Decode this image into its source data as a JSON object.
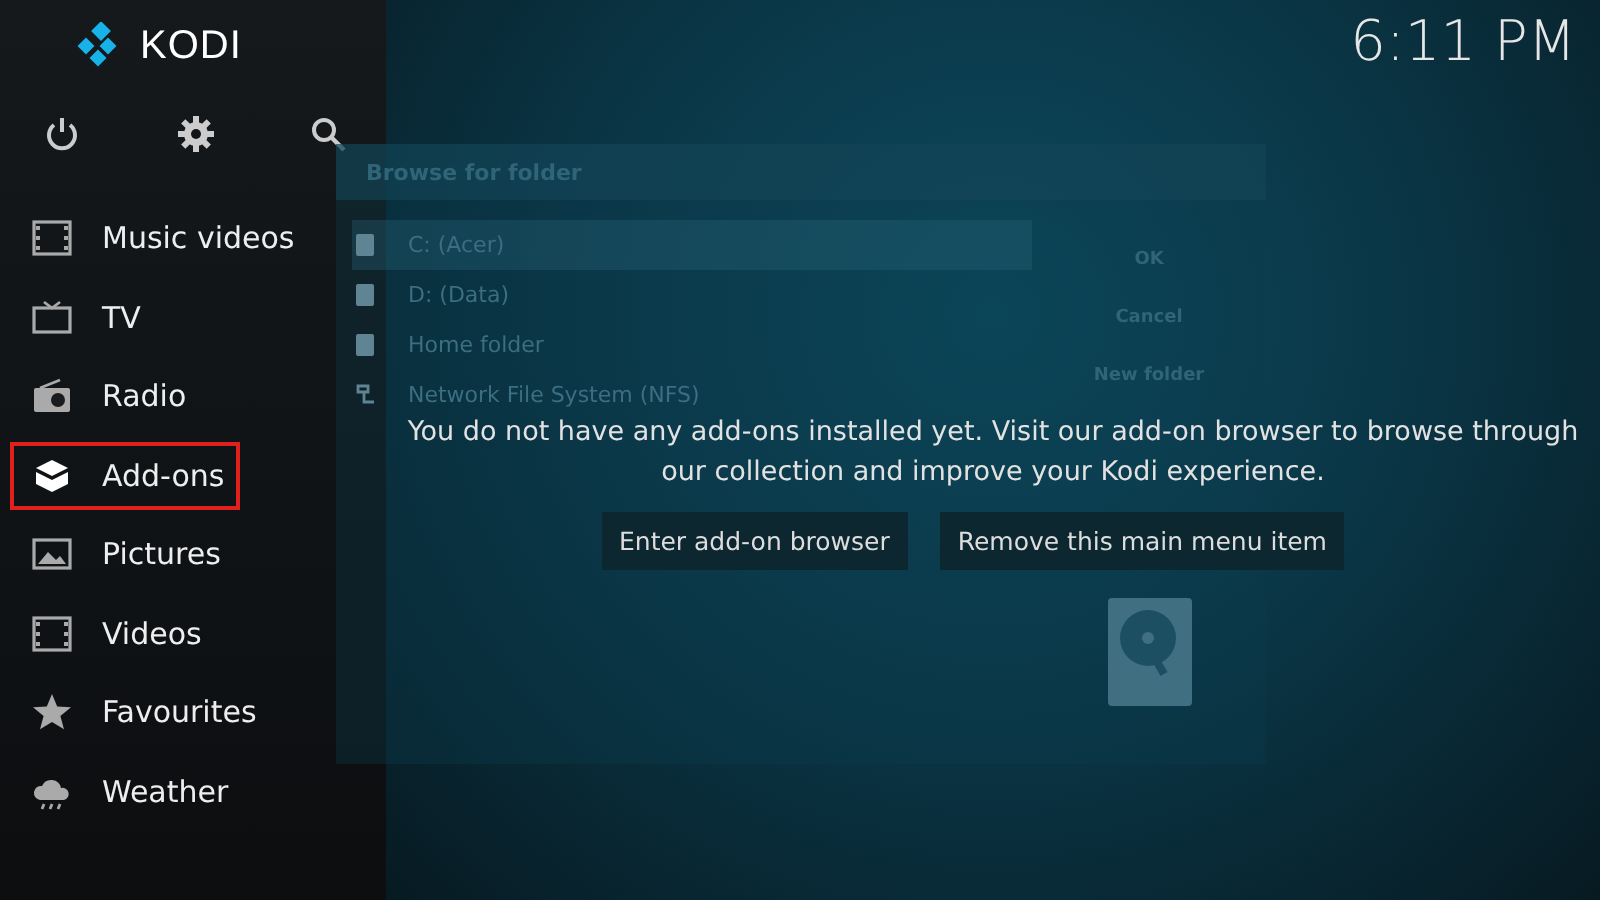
{
  "logo": {
    "text": "KODI"
  },
  "clock": "6:11 PM",
  "menu": [
    {
      "label": "Music videos",
      "kind": "film",
      "selected": false
    },
    {
      "label": "TV",
      "kind": "tv",
      "selected": false
    },
    {
      "label": "Radio",
      "kind": "radio",
      "selected": false
    },
    {
      "label": "Add-ons",
      "kind": "box",
      "selected": true
    },
    {
      "label": "Pictures",
      "kind": "picture",
      "selected": false
    },
    {
      "label": "Videos",
      "kind": "film",
      "selected": false
    },
    {
      "label": "Favourites",
      "kind": "star",
      "selected": false
    },
    {
      "label": "Weather",
      "kind": "cloud",
      "selected": false
    }
  ],
  "background_dialog": {
    "title": "Browse for folder",
    "items": [
      {
        "label": "C: (Acer)",
        "kind": "drive",
        "selected": true
      },
      {
        "label": "D: (Data)",
        "kind": "drive",
        "selected": false
      },
      {
        "label": "Home folder",
        "kind": "drive",
        "selected": false
      },
      {
        "label": "Network File System (NFS)",
        "kind": "network",
        "selected": false
      }
    ],
    "buttons": [
      "OK",
      "Cancel",
      "New folder"
    ]
  },
  "message": {
    "text": "You do not have any add-ons installed yet. Visit our add-on browser to browse through our collection and improve your Kodi experience.",
    "buttons": [
      "Enter add-on browser",
      "Remove this main menu item"
    ]
  }
}
